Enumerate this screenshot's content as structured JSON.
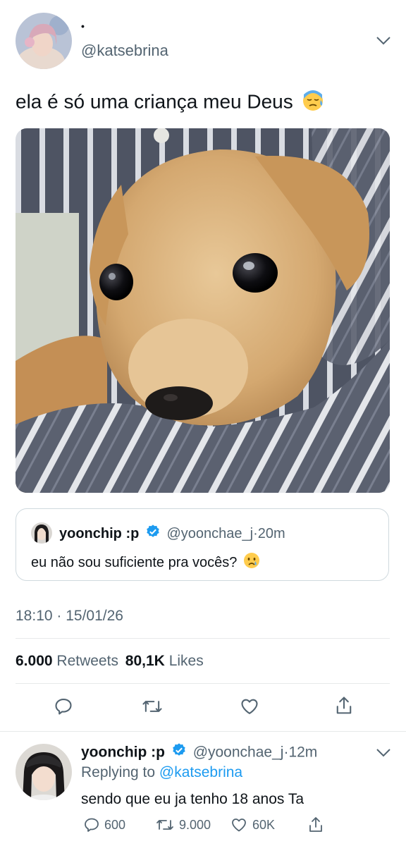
{
  "tweet": {
    "author": {
      "display_name": "•",
      "handle": "@katsebrina"
    },
    "text": "ela é só uma criança meu Deus",
    "text_emoji": "downcast-sweat-emoji",
    "image": {
      "subject": "puppy-photo"
    },
    "quote": {
      "display_name": "yoonchip :p",
      "handle": "@yoonchae_j",
      "dot": "·",
      "time": "20m",
      "text": "eu não sou suficiente pra vocês?",
      "text_emoji": "crying-face-emoji"
    },
    "timestamp": "18:10 · 15/01/26",
    "stats": {
      "retweets_count": "6.000",
      "retweets_label": "Retweets",
      "likes_count": "80,1K",
      "likes_label": "Likes"
    },
    "actions": [
      "reply-icon",
      "retweet-icon",
      "like-icon",
      "share-icon"
    ]
  },
  "reply": {
    "display_name": "yoonchip :p",
    "handle": "@yoonchae_j",
    "dot": "·",
    "time": "12m",
    "replying_to_label": "Replying to",
    "replying_to_handle": "@katsebrina",
    "text": "sendo que eu ja tenho 18 anos Ta",
    "stats": {
      "replies": "600",
      "retweets": "9.000",
      "likes": "60K"
    }
  },
  "colors": {
    "accent": "#1d9bf0",
    "secondary_text": "#536471",
    "divider": "#e7e9ea"
  }
}
